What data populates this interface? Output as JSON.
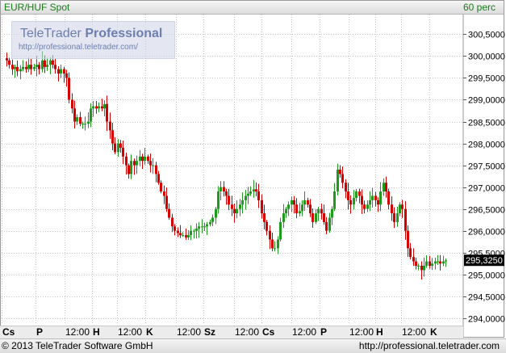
{
  "header": {
    "symbol": "EUR/HUF Spot",
    "interval": "60 perc"
  },
  "watermark": {
    "brand_regular": "TeleTrader ",
    "brand_bold": "Professional",
    "url": "http://professional.teletrader.com/"
  },
  "footer": {
    "copyright": "© 2013 TeleTrader Software GmbH",
    "url": "http://professional.teletrader.com"
  },
  "chart_data": {
    "type": "candlestick",
    "title": "EUR/HUF Spot",
    "interval": "60 perc",
    "y_ticks": [
      "300,5000",
      "300,0000",
      "299,5000",
      "299,0000",
      "298,5000",
      "298,0000",
      "297,5000",
      "297,0000",
      "296,5000",
      "296,0000",
      "295,5000",
      "295,0000",
      "294,5000",
      "294,0000"
    ],
    "ylim": [
      293.85,
      300.95
    ],
    "x_labels": [
      {
        "label": "Cs",
        "bold": true,
        "x": 2
      },
      {
        "label": "P",
        "bold": true,
        "x": 44
      },
      {
        "label": "12:00",
        "bold": false,
        "x": 80
      },
      {
        "label": "H",
        "bold": true,
        "x": 114
      },
      {
        "label": "12:00",
        "bold": false,
        "x": 145
      },
      {
        "label": "K",
        "bold": true,
        "x": 180
      },
      {
        "label": "12:00",
        "bold": false,
        "x": 218
      },
      {
        "label": "Sz",
        "bold": true,
        "x": 252
      },
      {
        "label": "12:00",
        "bold": false,
        "x": 290
      },
      {
        "label": "Cs",
        "bold": true,
        "x": 324
      },
      {
        "label": "12:00",
        "bold": false,
        "x": 361
      },
      {
        "label": "P",
        "bold": true,
        "x": 396
      },
      {
        "label": "12:00",
        "bold": false,
        "x": 432
      },
      {
        "label": "H",
        "bold": true,
        "x": 465
      },
      {
        "label": "12:00",
        "bold": false,
        "x": 497
      },
      {
        "label": "K",
        "bold": true,
        "x": 532
      }
    ],
    "last_price": "295,3250",
    "last_value": 295.325,
    "closes": [
      299.9,
      299.8,
      299.7,
      299.75,
      299.65,
      299.7,
      299.75,
      299.7,
      299.8,
      299.7,
      299.75,
      299.8,
      299.7,
      299.9,
      299.75,
      299.8,
      299.9,
      299.8,
      299.7,
      299.6,
      299.7,
      299.6,
      299.5,
      299.0,
      298.8,
      298.5,
      298.6,
      298.45,
      298.45,
      298.45,
      298.5,
      298.8,
      298.85,
      298.8,
      298.85,
      298.8,
      298.9,
      298.5,
      298.3,
      298.0,
      297.8,
      298.0,
      297.9,
      297.7,
      297.5,
      297.3,
      297.6,
      297.5,
      297.6,
      297.7,
      297.6,
      297.7,
      297.6,
      297.5,
      297.5,
      297.3,
      297.1,
      296.9,
      296.8,
      296.5,
      296.3,
      296.1,
      296.0,
      295.95,
      295.9,
      295.9,
      295.85,
      295.9,
      296.0,
      296.0,
      296.05,
      296.1,
      296.1,
      296.1,
      296.15,
      296.2,
      296.3,
      296.5,
      296.9,
      297.0,
      296.9,
      296.8,
      296.6,
      296.5,
      296.4,
      296.5,
      296.6,
      296.7,
      296.8,
      296.85,
      296.9,
      296.95,
      296.9,
      296.7,
      296.4,
      296.2,
      296.0,
      295.8,
      295.6,
      295.6,
      295.8,
      296.2,
      296.4,
      296.5,
      296.6,
      296.7,
      296.6,
      296.4,
      296.45,
      296.6,
      296.7,
      296.6,
      296.4,
      296.2,
      296.4,
      296.5,
      296.4,
      296.2,
      296.0,
      296.3,
      296.5,
      296.9,
      297.4,
      297.3,
      297.1,
      296.9,
      296.7,
      296.6,
      296.75,
      296.9,
      296.8,
      296.6,
      296.5,
      296.6,
      296.7,
      296.8,
      296.7,
      296.6,
      296.9,
      297.1,
      296.9,
      296.6,
      296.4,
      296.2,
      296.4,
      296.6,
      296.5,
      296.0,
      295.6,
      295.4,
      295.3,
      295.2,
      295.2,
      295.1,
      295.2,
      295.3,
      295.2,
      295.25,
      295.3,
      295.3,
      295.25,
      295.3,
      295.325
    ]
  }
}
